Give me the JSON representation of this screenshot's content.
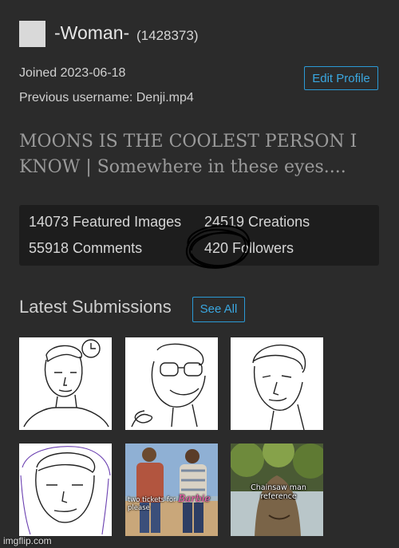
{
  "profile": {
    "username": "-Woman-",
    "user_id": "(1428373)",
    "joined": "Joined 2023-06-18",
    "previous_username": "Previous username: Denji.mp4",
    "edit_label": "Edit Profile",
    "bio": "MOONS IS THE COOLEST PERSON I KNOW | Somewhere in these eyes...."
  },
  "stats": {
    "featured": "14073 Featured Images",
    "creations": "24519 Creations",
    "comments": "55918 Comments",
    "followers": "420 Followers"
  },
  "latest": {
    "heading": "Latest Submissions",
    "see_all_label": "See All",
    "thumbnails": [
      {
        "caption": ""
      },
      {
        "caption": ""
      },
      {
        "caption": ""
      },
      {
        "caption": ""
      },
      {
        "caption_before": "two tickets for",
        "caption_barbie": "Barbie",
        "caption_after": "please"
      },
      {
        "caption": "Chainsaw man reference"
      }
    ]
  },
  "watermark": "imgflip.com",
  "colors": {
    "background": "#2b2b2b",
    "accent": "#2b9ad6",
    "panel": "#1d1d1d",
    "bio_text": "#9a9a9a"
  }
}
